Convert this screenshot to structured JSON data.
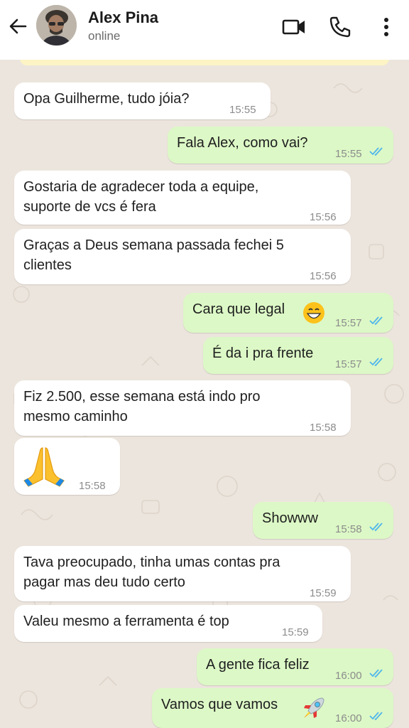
{
  "header": {
    "contact_name": "Alex Pina",
    "status": "online",
    "icons": [
      "back-arrow-icon",
      "video-call-icon",
      "voice-call-icon",
      "more-options-icon"
    ]
  },
  "messages": [
    {
      "dir": "in",
      "text": "Opa Guilherme, tudo jóia?",
      "time": "15:55"
    },
    {
      "dir": "out",
      "text": "Fala Alex, como vai?",
      "time": "15:55",
      "read": true
    },
    {
      "dir": "in",
      "text": "Gostaria de agradecer toda a equipe,\nsuporte de vcs é fera",
      "time": "15:56"
    },
    {
      "dir": "in",
      "text": "Graças a Deus semana passada fechei 5\nclientes",
      "time": "15:56"
    },
    {
      "dir": "out",
      "text": "Cara que legal",
      "emoji": "grinning-face",
      "time": "15:57",
      "read": true
    },
    {
      "dir": "out",
      "text": "É da i pra frente",
      "time": "15:57",
      "read": true
    },
    {
      "dir": "in",
      "text": "Fiz 2.500, esse semana está indo pro\nmesmo caminho",
      "time": "15:58"
    },
    {
      "dir": "in",
      "emoji": "folded-hands",
      "time": "15:58"
    },
    {
      "dir": "out",
      "text": "Showww",
      "time": "15:58",
      "read": true
    },
    {
      "dir": "in",
      "text": "Tava preocupado, tinha umas contas pra\npagar mas deu tudo certo",
      "time": "15:59"
    },
    {
      "dir": "in",
      "text": "Valeu mesmo a ferramenta é top",
      "time": "15:59"
    },
    {
      "dir": "out",
      "text": "A gente fica feliz",
      "time": "16:00",
      "read": true
    },
    {
      "dir": "out",
      "text": "Vamos que vamos",
      "emoji": "rocket",
      "time": "16:00",
      "read": true
    }
  ],
  "colors": {
    "background": "#ece5dd",
    "incoming_bubble": "#ffffff",
    "outgoing_bubble": "#dcf8c6",
    "read_tick": "#4fb6ec",
    "header": "#ffffff"
  }
}
